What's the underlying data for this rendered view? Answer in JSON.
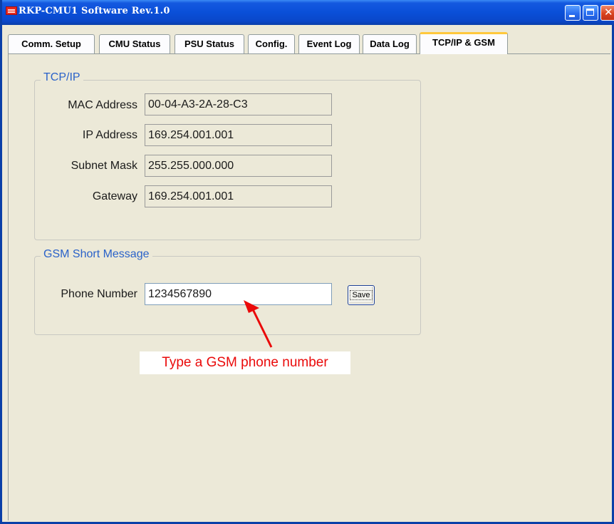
{
  "window": {
    "title": "RKP-CMU1 Software  Rev.1.0",
    "colors": {
      "title_bar": "#0a4fd8",
      "close_button": "#d9431f"
    }
  },
  "tabs": [
    {
      "label": "Comm. Setup",
      "active": false
    },
    {
      "label": "CMU Status",
      "active": false
    },
    {
      "label": "PSU Status",
      "active": false
    },
    {
      "label": "Config.",
      "active": false
    },
    {
      "label": "Event Log",
      "active": false
    },
    {
      "label": "Data Log",
      "active": false
    },
    {
      "label": "TCP/IP & GSM",
      "active": true
    }
  ],
  "tcpip": {
    "legend": "TCP/IP",
    "mac_label": "MAC Address",
    "mac_value": "00-04-A3-2A-28-C3",
    "ip_label": "IP Address",
    "ip_value": "169.254.001.001",
    "subnet_label": "Subnet Mask",
    "subnet_value": "255.255.000.000",
    "gateway_label": "Gateway",
    "gateway_value": "169.254.001.001"
  },
  "gsm": {
    "legend": "GSM Short Message",
    "phone_label": "Phone Number",
    "phone_value": "1234567890",
    "save_label": "Save"
  },
  "annotation": {
    "text": "Type a GSM phone number",
    "color": "#ea0a0a"
  },
  "icons": [
    "app-icon",
    "minimize-icon",
    "maximize-icon",
    "close-icon",
    "annotation-arrow-icon"
  ]
}
